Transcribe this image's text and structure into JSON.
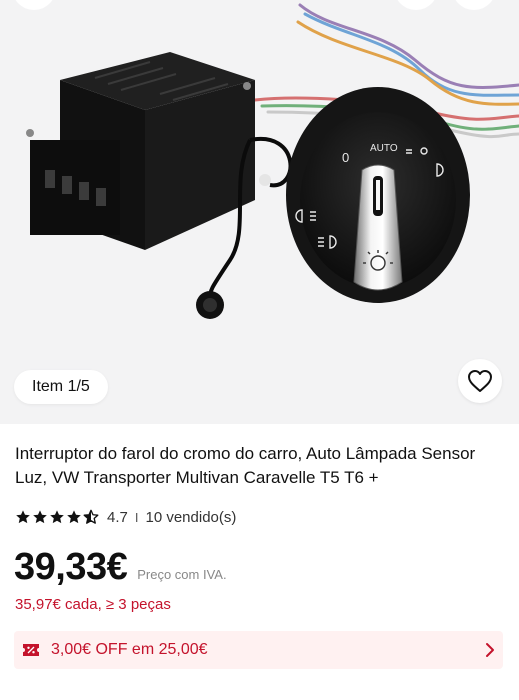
{
  "gallery": {
    "item_indicator": "Item 1/5",
    "product_image_labels": {
      "auto": "AUTO",
      "zero": "0"
    }
  },
  "product": {
    "title": "Interruptor do farol do cromo do carro, Auto Lâmpada Sensor Luz, VW Transporter Multivan Caravelle T5 T6 +",
    "rating_value": "4.7",
    "rating_stars": 4.5,
    "separator": "I",
    "sold": "10 vendido(s)",
    "price": "39,33€",
    "price_note": "Preço com IVA.",
    "bulk_price": "35,97€ cada, ≥ 3 peças"
  },
  "coupon": {
    "text": "3,00€ OFF em 25,00€"
  },
  "colors": {
    "accent_red": "#c4132c",
    "coupon_bg": "#fff1f1",
    "hero_bg": "#f3f3f4"
  },
  "icons": {
    "favorite": "heart-outline-icon",
    "coupon": "coupon-ticket-icon",
    "chevron": "chevron-right-icon",
    "rating": "star-icon"
  }
}
